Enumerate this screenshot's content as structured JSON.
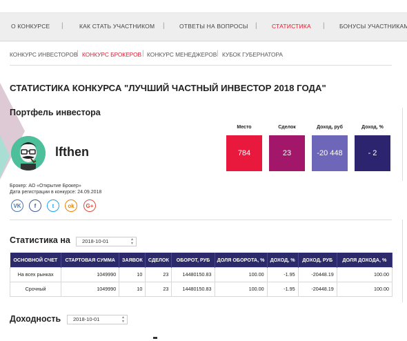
{
  "topnav": {
    "items": [
      {
        "label": "О конкурсе"
      },
      {
        "label": "Как стать участником"
      },
      {
        "label": "Ответы на вопросы"
      },
      {
        "label": "Статистика"
      },
      {
        "label": "Бонусы участникам"
      }
    ],
    "active": "Статистика"
  },
  "subnav": {
    "items": [
      {
        "label": "Конкурс инвесторов"
      },
      {
        "label": "Конкурс брокеров"
      },
      {
        "label": "Конкурс менеджеров"
      },
      {
        "label": "Кубок губернатора"
      }
    ],
    "active": "Конкурс брокеров"
  },
  "page": {
    "title": "Статистика конкурса \"Лучший частный инвестор 2018 года\"",
    "portfolio_title": "Портфель инвестора"
  },
  "investor": {
    "username": "lfthen",
    "broker": "Брокер: АО «Открытие Брокер»",
    "registration": "Дата регистрации в конкурсе: 24.09.2018",
    "socials": [
      {
        "icon": "vk-icon",
        "glyph": "VK",
        "color": "#4a76a8"
      },
      {
        "icon": "facebook-icon",
        "glyph": "f",
        "color": "#3b5998"
      },
      {
        "icon": "twitter-icon",
        "glyph": "t",
        "color": "#1da1f2"
      },
      {
        "icon": "odnoklassniki-icon",
        "glyph": "ok",
        "color": "#ee8208"
      },
      {
        "icon": "google-plus-icon",
        "glyph": "G+",
        "color": "#dd4b39"
      }
    ]
  },
  "tiles": [
    {
      "label": "Место",
      "value": "784",
      "color": "#e8193c"
    },
    {
      "label": "Сделок",
      "value": "23",
      "color": "#a3176b"
    },
    {
      "label": "Доход, руб",
      "value": "-20 448",
      "color": "#6e66b8"
    },
    {
      "label": "Доход, %",
      "value": "- 2",
      "color": "#2d2470"
    }
  ],
  "stats": {
    "heading": "Статистика на",
    "date": "2018-10-01",
    "columns": [
      "Основной счет",
      "Стартовая сумма",
      "Заявок",
      "Сделок",
      "Оборот, руб",
      "Доля оборота, %",
      "Доход, %",
      "Доход, руб",
      "Доля дохода, %"
    ],
    "rows": [
      [
        "На всех рынках",
        "1049990",
        "10",
        "23",
        "14480150.83",
        "100.00",
        "-1.95",
        "-20448.19",
        "100.00"
      ],
      [
        "Срочный",
        "1049990",
        "10",
        "23",
        "14480150.83",
        "100.00",
        "-1.95",
        "-20448.19",
        "100.00"
      ]
    ]
  },
  "income": {
    "heading": "Доходность",
    "date": "2018-10-01"
  }
}
